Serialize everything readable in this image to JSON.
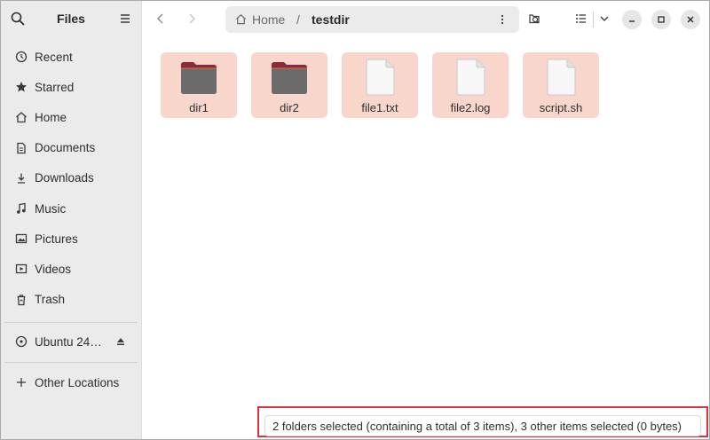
{
  "app": {
    "title": "Files"
  },
  "sidebar": {
    "items": [
      {
        "label": "Recent",
        "icon": "clock-icon"
      },
      {
        "label": "Starred",
        "icon": "star-icon"
      },
      {
        "label": "Home",
        "icon": "home-icon"
      },
      {
        "label": "Documents",
        "icon": "document-icon"
      },
      {
        "label": "Downloads",
        "icon": "download-icon"
      },
      {
        "label": "Music",
        "icon": "music-note-icon"
      },
      {
        "label": "Pictures",
        "icon": "picture-icon"
      },
      {
        "label": "Videos",
        "icon": "video-icon"
      },
      {
        "label": "Trash",
        "icon": "trash-icon"
      }
    ],
    "device": {
      "label": "Ubuntu 24…",
      "icon": "disc-icon"
    },
    "other": {
      "label": "Other Locations",
      "icon": "plus-icon"
    }
  },
  "pathbar": {
    "home": "Home",
    "separator": "/",
    "current": "testdir"
  },
  "files": [
    {
      "name": "dir1",
      "type": "folder"
    },
    {
      "name": "dir2",
      "type": "folder"
    },
    {
      "name": "file1.txt",
      "type": "file"
    },
    {
      "name": "file2.log",
      "type": "file"
    },
    {
      "name": "script.sh",
      "type": "file"
    }
  ],
  "status": {
    "text": "2 folders selected (containing a total of 3 items), 3 other items selected (0 bytes)"
  },
  "colors": {
    "selection": "#f9d6cb",
    "folder_body": "#6b6b6b",
    "folder_tab": "#8a2a3f",
    "highlight_border": "#e0303b"
  }
}
